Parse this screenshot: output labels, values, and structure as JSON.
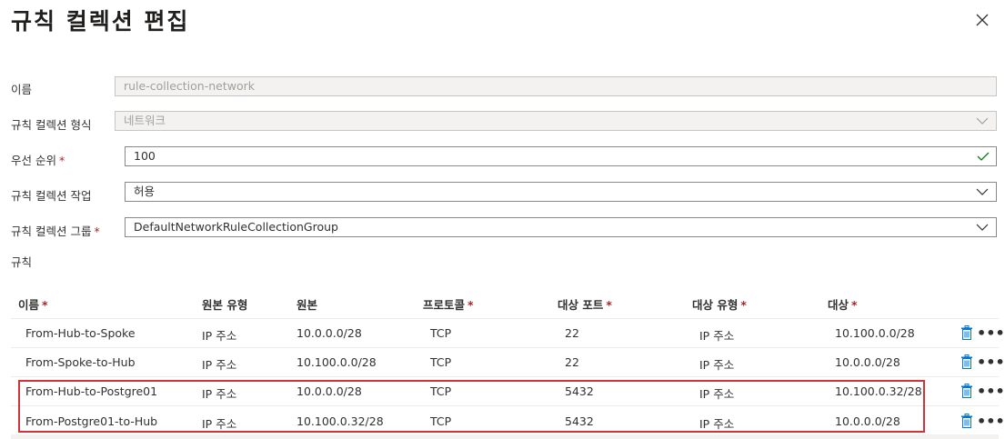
{
  "title": "규칙 컬렉션 편집",
  "form": {
    "name": {
      "label": "이름",
      "value": "rule-collection-network"
    },
    "type": {
      "label": "규칙 컬렉션 형식",
      "value": "네트워크"
    },
    "priority": {
      "label": "우선 순위",
      "required": "*",
      "value": "100"
    },
    "action": {
      "label": "규칙 컬렉션 작업",
      "value": "허용"
    },
    "group": {
      "label": "규칙 컬렉션 그룹",
      "required": "*",
      "value": "DefaultNetworkRuleCollectionGroup"
    }
  },
  "rules_label": "규칙",
  "table": {
    "headers": [
      {
        "text": "이름",
        "required": "*"
      },
      {
        "text": "원본 유형",
        "required": ""
      },
      {
        "text": "원본",
        "required": ""
      },
      {
        "text": "프로토콜",
        "required": "*"
      },
      {
        "text": "대상 포트",
        "required": "*"
      },
      {
        "text": "대상 유형",
        "required": "*"
      },
      {
        "text": "대상",
        "required": "*"
      }
    ],
    "rows": [
      [
        "From-Hub-to-Spoke",
        "IP 주소",
        "10.0.0.0/28",
        "TCP",
        "22",
        "IP 주소",
        "10.100.0.0/28"
      ],
      [
        "From-Spoke-to-Hub",
        "IP 주소",
        "10.100.0.0/28",
        "TCP",
        "22",
        "IP 주소",
        "10.0.0.0/28"
      ],
      [
        "From-Hub-to-Postgre01",
        "IP 주소",
        "10.0.0.0/28",
        "TCP",
        "5432",
        "IP 주소",
        "10.100.0.32/28"
      ],
      [
        "From-Postgre01-to-Hub",
        "IP 주소",
        "10.100.0.32/28",
        "TCP",
        "5432",
        "IP 주소",
        "10.0.0.0/28"
      ]
    ]
  },
  "icons": {
    "close": "close-icon",
    "delete": "trash-icon",
    "more": "more-icon",
    "chevron": "chevron-down-icon",
    "valid": "checkmark-icon"
  },
  "colors": {
    "required": "#a4262c",
    "highlight": "#d13438",
    "trash": "#0078d4",
    "valid": "#107c10"
  }
}
